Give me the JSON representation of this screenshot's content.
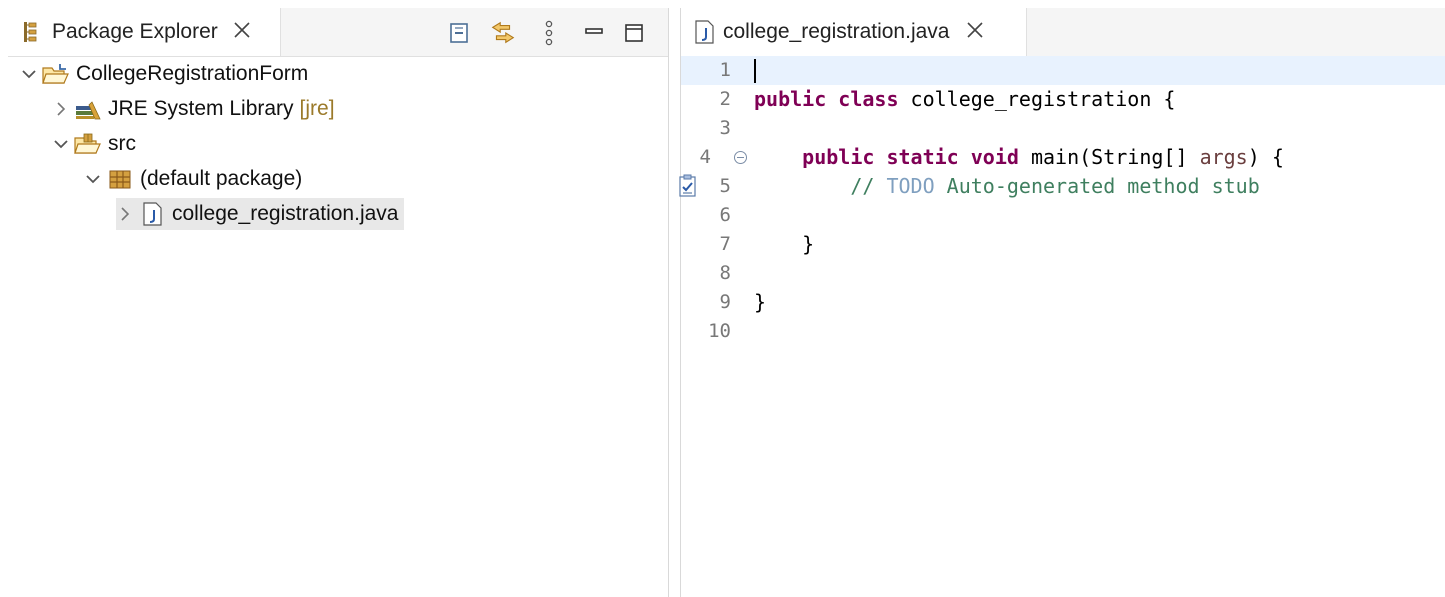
{
  "package_explorer": {
    "tab_title": "Package Explorer",
    "toolbar_icons": [
      "collapse-all-icon",
      "link-with-editor-icon",
      "view-menu-icon",
      "minimize-icon",
      "maximize-icon"
    ],
    "tree": {
      "project": "CollegeRegistrationForm",
      "jre_library": "JRE System Library",
      "jre_decoration": "[jre]",
      "src_folder": "src",
      "package": "(default package)",
      "file": "college_registration.java"
    }
  },
  "editor": {
    "tab_title": "college_registration.java",
    "line_numbers": [
      "1",
      "2",
      "3",
      "4",
      "5",
      "6",
      "7",
      "8",
      "9",
      "10"
    ],
    "code": {
      "l2_kw1": "public",
      "l2_kw2": "class",
      "l2_rest": " college_registration {",
      "l4_indent": "    ",
      "l4_kw1": "public",
      "l4_kw2": "static",
      "l4_kw3": "void",
      "l4_rest": " main(String[] ",
      "l4_param": "args",
      "l4_end": ") {",
      "l5_indent": "        ",
      "l5_comment_start": "// ",
      "l5_todo": "TODO",
      "l5_comment_rest": " Auto-generated method stub",
      "l7": "    }",
      "l9": "}"
    }
  },
  "colors": {
    "keyword": "#7f0055",
    "comment": "#3f7f5f",
    "todo_tag": "#7f9fbf",
    "current_line": "#e8f2fe"
  }
}
